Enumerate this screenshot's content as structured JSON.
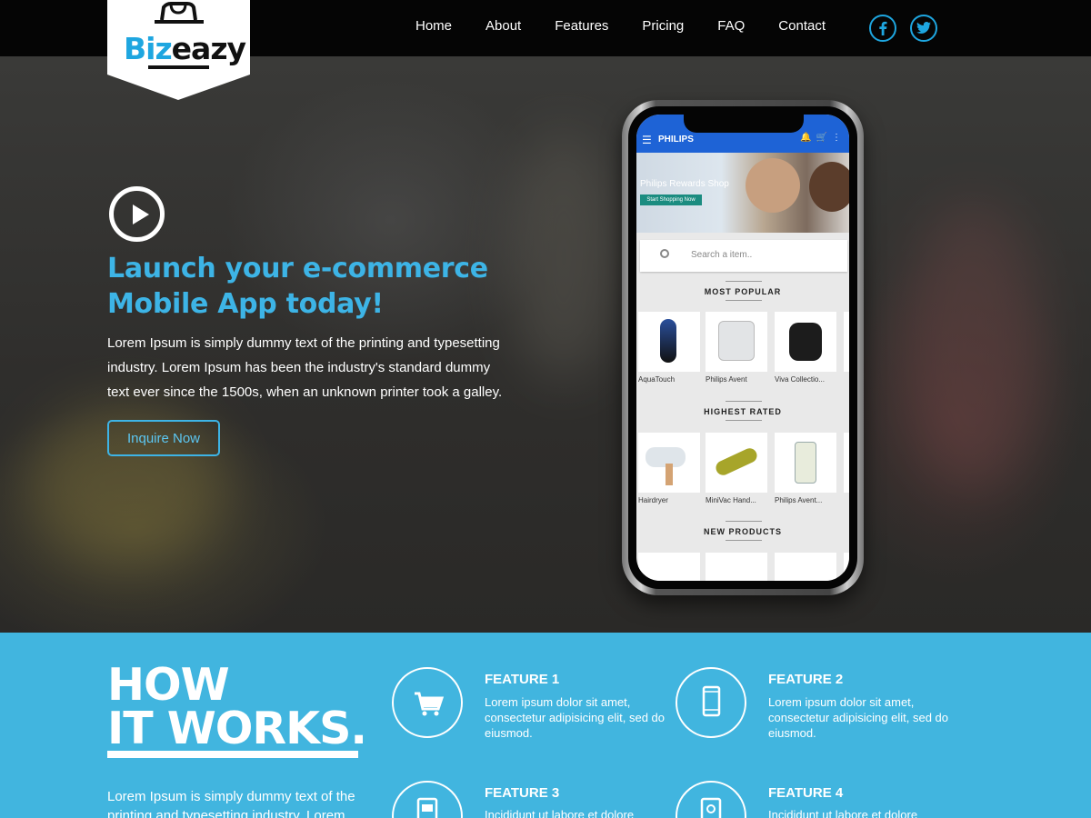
{
  "brand": {
    "logo_part1": "Biz",
    "logo_part2": "eazy"
  },
  "nav": {
    "items": [
      "Home",
      "About",
      "Features",
      "Pricing",
      "FAQ",
      "Contact"
    ],
    "social": [
      "facebook-icon",
      "twitter-icon"
    ]
  },
  "colors": {
    "accent": "#3db4e6",
    "topbar": "#050505",
    "section_bg": "#41b5df"
  },
  "hero": {
    "title_line1": "Launch your e-commerce",
    "title_line2": "Mobile App today!",
    "text": "Lorem Ipsum is simply dummy text of the printing and typesetting industry. Lorem Ipsum has been the industry's standard dummy text ever since the 1500s, when an unknown printer took a galley.",
    "cta": "Inquire Now"
  },
  "phone": {
    "app_title": "PHILIPS",
    "banner_title": "Philips Rewards Shop",
    "banner_button": "Start Shopping Now",
    "search_placeholder": "Search a item..",
    "sections": [
      {
        "title": "MOST POPULAR",
        "items": [
          "AquaTouch",
          "Philips Avent",
          "Viva Collectio..."
        ]
      },
      {
        "title": "HIGHEST RATED",
        "items": [
          "Hairdryer",
          "MiniVac Hand...",
          "Philips Avent..."
        ]
      },
      {
        "title": "NEW PRODUCTS",
        "items": [
          "",
          "",
          ""
        ]
      }
    ]
  },
  "how": {
    "title_line1": "HOW",
    "title_line2": "IT WORKS.",
    "text": "Lorem Ipsum is simply dummy text of the printing and typesetting industry. Lorem",
    "features": [
      {
        "title": "FEATURE 1",
        "text": "Lorem ipsum dolor sit amet, consectetur adipisicing elit, sed do eiusmod.",
        "icon": "cart-icon"
      },
      {
        "title": "FEATURE 2",
        "text": "Lorem ipsum dolor sit amet, consectetur adipisicing elit, sed do eiusmod.",
        "icon": "mobile-icon"
      },
      {
        "title": "FEATURE 3",
        "text": "Incididunt ut labore et dolore",
        "icon": "mobile-cart-icon"
      },
      {
        "title": "FEATURE 4",
        "text": "Incididunt ut labore et dolore",
        "icon": "mobile-search-icon"
      }
    ]
  }
}
